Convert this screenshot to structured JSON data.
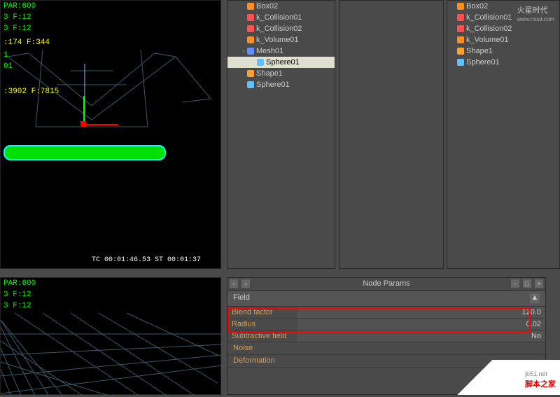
{
  "viewport1": {
    "par": "PAR:600",
    "f1": "3 F:12",
    "f2": "3 F:12",
    "info1": ":174 F:344",
    "l1": "1",
    "l2": "01",
    "l3": ":3902 F:7815",
    "tc": "TC 00:01:46.53   ST 00:01:37"
  },
  "viewport2": {
    "par": "PAR:600",
    "f1": "3 F:12",
    "f2": "3 F:12"
  },
  "tree1": {
    "items": [
      {
        "label": "Box02",
        "icon": "ic-box",
        "depth": 1
      },
      {
        "label": "k_Collision01",
        "icon": "ic-coll",
        "depth": 1
      },
      {
        "label": "k_Collision02",
        "icon": "ic-coll",
        "depth": 1
      },
      {
        "label": "k_Volume01",
        "icon": "ic-vol",
        "depth": 1
      },
      {
        "label": "Mesh01",
        "icon": "ic-mesh",
        "depth": 1,
        "expand": "-"
      },
      {
        "label": "Sphere01",
        "icon": "ic-sphere",
        "depth": 2,
        "sel": true
      },
      {
        "label": "Shape1",
        "icon": "ic-shape",
        "depth": 1
      },
      {
        "label": "Sphere01",
        "icon": "ic-sphere",
        "depth": 1
      }
    ]
  },
  "tree3": {
    "items": [
      {
        "label": "Box02",
        "icon": "ic-box"
      },
      {
        "label": "k_Collision01",
        "icon": "ic-coll"
      },
      {
        "label": "k_Collision02",
        "icon": "ic-coll"
      },
      {
        "label": "k_Volume01",
        "icon": "ic-vol"
      },
      {
        "label": "Shape1",
        "icon": "ic-shape"
      },
      {
        "label": "Sphere01",
        "icon": "ic-sphere"
      }
    ]
  },
  "params": {
    "title": "Node Params",
    "field_label": "Field",
    "rows": [
      {
        "name": "Blend factor",
        "val": "120.0"
      },
      {
        "name": "Radius",
        "val": "0.02"
      },
      {
        "name": "Subtractive field",
        "val": "No"
      }
    ],
    "sec_noise": "Noise",
    "sec_def": "Deformation"
  },
  "watermark": {
    "brand": "火星时代",
    "domain": "www.hxsd.com"
  },
  "watermark2": {
    "site": "jb51.net",
    "cn": "脚本之家"
  }
}
